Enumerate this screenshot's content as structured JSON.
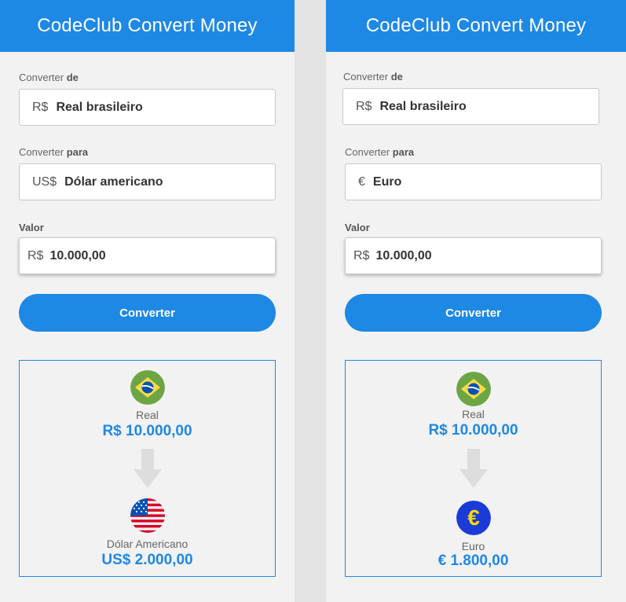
{
  "panels": [
    {
      "title": "CodeClub Convert Money",
      "from_label": "Converter",
      "from_label_bold": "de",
      "from_symbol": "R$",
      "from_name": "Real brasileiro",
      "to_label": "Converter",
      "to_label_bold": "para",
      "to_symbol": "US$",
      "to_name": "Dólar americano",
      "value_label": "Valor",
      "value_symbol": "R$",
      "value": "10.000,00",
      "button_label": "Converter",
      "result": {
        "from_name": "Real",
        "from_amount": "R$ 10.000,00",
        "from_icon": "brazil-flag-icon",
        "to_name": "Dólar Americano",
        "to_amount": "US$ 2.000,00",
        "to_icon": "usa-flag-icon"
      }
    },
    {
      "title": "CodeClub Convert Money",
      "from_label": "Converter",
      "from_label_bold": "de",
      "from_symbol": "R$",
      "from_name": "Real brasileiro",
      "to_label": "Converter",
      "to_label_bold": "para",
      "to_symbol": "€",
      "to_name": "Euro",
      "value_label": "Valor",
      "value_symbol": "R$",
      "value": "10.000,00",
      "button_label": "Converter",
      "result": {
        "from_name": "Real",
        "from_amount": "R$ 10.000,00",
        "from_icon": "brazil-flag-icon",
        "to_name": "Euro",
        "to_amount": "€ 1.800,00",
        "to_icon": "euro-icon"
      }
    }
  ],
  "colors": {
    "accent": "#1e88e5",
    "panel_bg": "#f2f2f2",
    "gutter_bg": "#e4e4e4",
    "arrow": "#dddddd"
  }
}
